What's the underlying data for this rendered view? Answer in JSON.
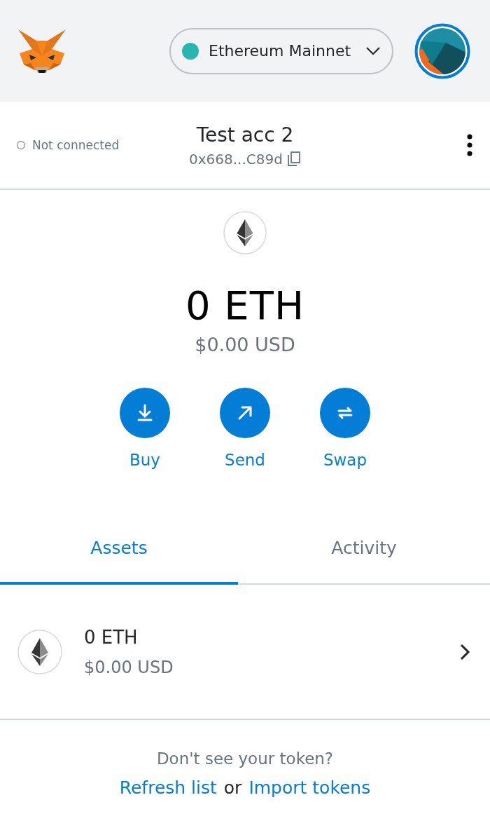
{
  "header": {
    "network": {
      "name": "Ethereum Mainnet"
    }
  },
  "account": {
    "connection": "Not connected",
    "connected": false,
    "name": "Test acc 2",
    "address": "0x668...C89d"
  },
  "balance": {
    "primary": "0 ETH",
    "secondary": "$0.00 USD"
  },
  "actions": [
    {
      "kind": "buy",
      "label": "Buy"
    },
    {
      "kind": "send",
      "label": "Send"
    },
    {
      "kind": "swap",
      "label": "Swap"
    }
  ],
  "tabs": [
    {
      "label": "Assets",
      "selected": true
    },
    {
      "label": "Activity",
      "selected": false
    }
  ],
  "assets": [
    {
      "amount": "0 ETH",
      "value": "$0.00 USD"
    }
  ],
  "footer": {
    "prompt": "Don't see your token?",
    "refresh_link": "Refresh list",
    "separator": "or",
    "import_link": "Import tokens"
  }
}
